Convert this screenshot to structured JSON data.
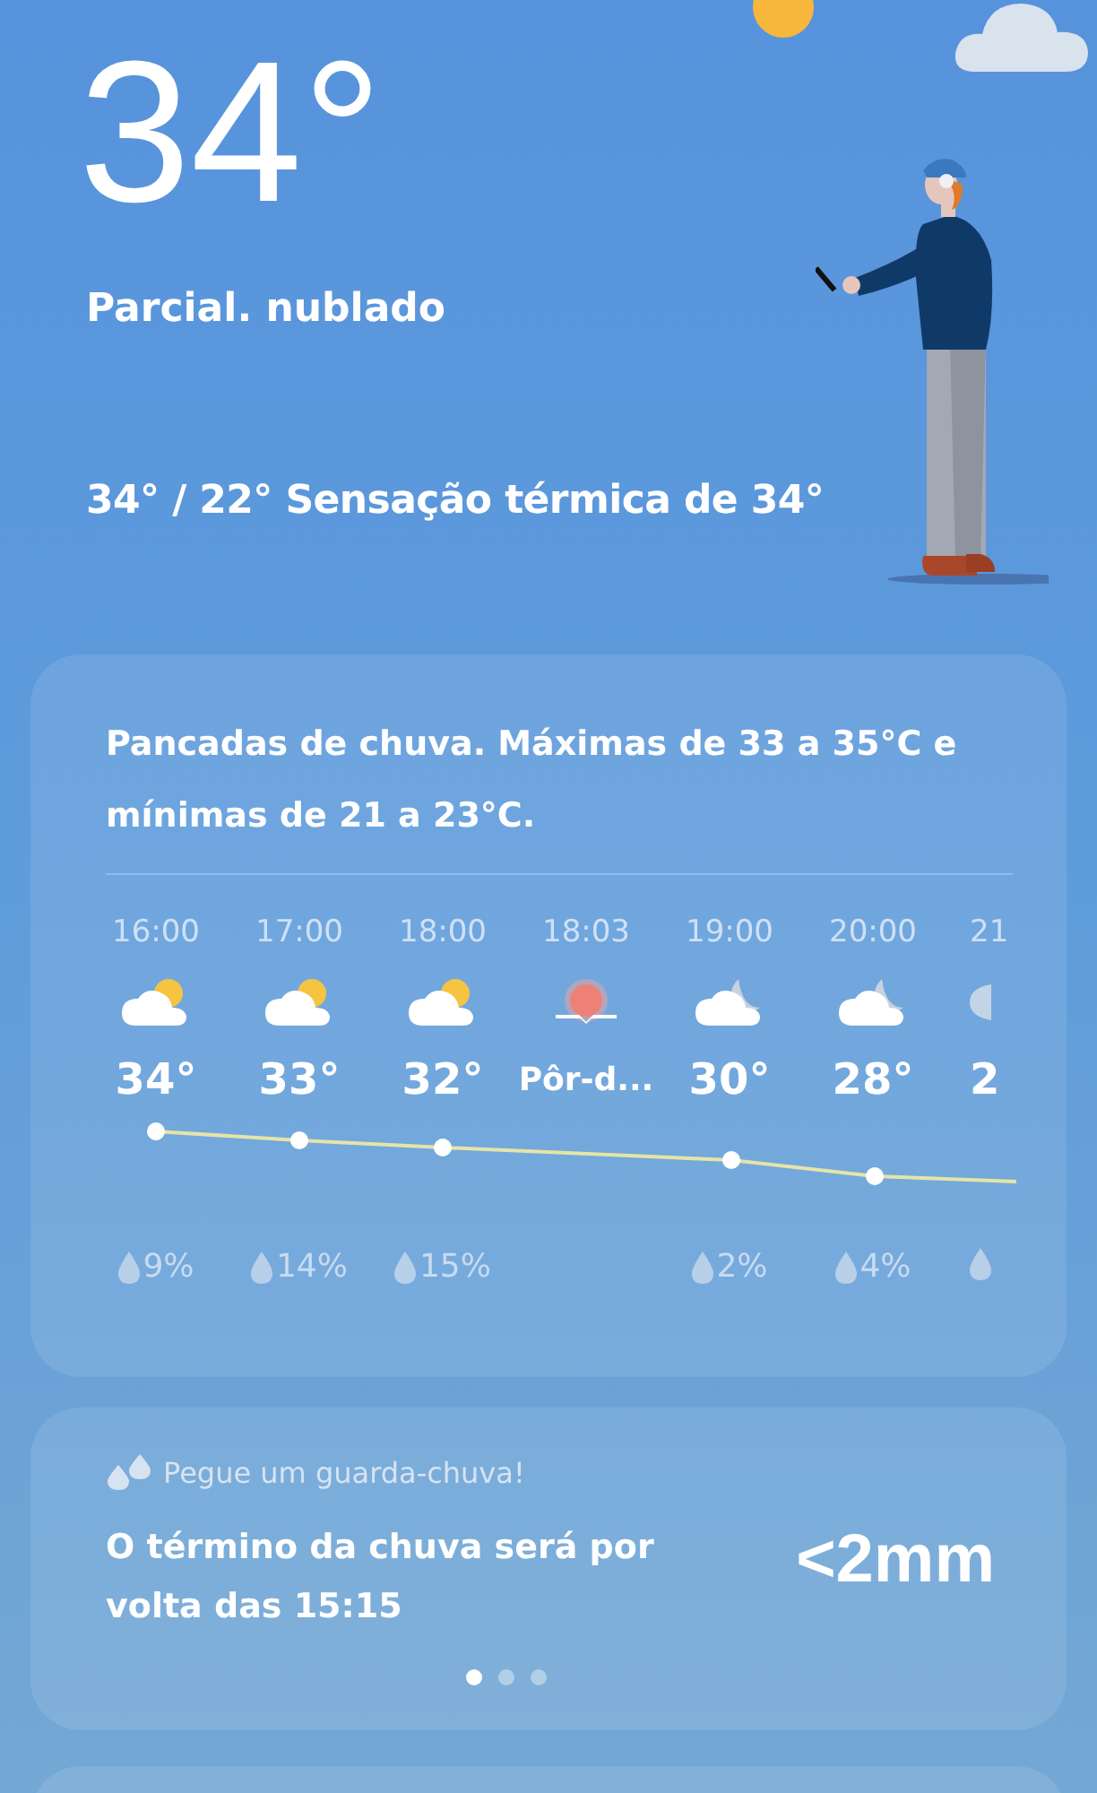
{
  "current": {
    "temperature": "34°",
    "condition": "Parcial. nublado",
    "range_feels": "34° / 22° Sensação térmica de 34°"
  },
  "forecast_card": {
    "summary": "Pancadas de chuva. Máximas de 33 a 35°C e mínimas de 21 a 23°C.",
    "hours": [
      {
        "time": "16:00",
        "kind": "partly-cloudy-day",
        "temp": "34°",
        "precip": "9%"
      },
      {
        "time": "17:00",
        "kind": "partly-cloudy-day",
        "temp": "33°",
        "precip": "14%"
      },
      {
        "time": "18:00",
        "kind": "partly-cloudy-day",
        "temp": "32°",
        "precip": "15%"
      },
      {
        "time": "18:03",
        "kind": "sunset",
        "temp": "Pôr-d..."
      },
      {
        "time": "19:00",
        "kind": "partly-cloudy-night",
        "temp": "30°",
        "precip": "2%"
      },
      {
        "time": "20:00",
        "kind": "partly-cloudy-night",
        "temp": "28°",
        "precip": "4%"
      },
      {
        "time": "21",
        "kind": "moon",
        "temp": "2",
        "precip_icon_only": true,
        "cut": true
      }
    ]
  },
  "rain_card": {
    "header": "Pegue um guarda-chuva!",
    "message": "O término da chuva será por volta das 15:15",
    "amount": "<2mm",
    "pager": [
      {
        "selected": true
      },
      {
        "selected": false
      },
      {
        "selected": false
      }
    ]
  }
}
